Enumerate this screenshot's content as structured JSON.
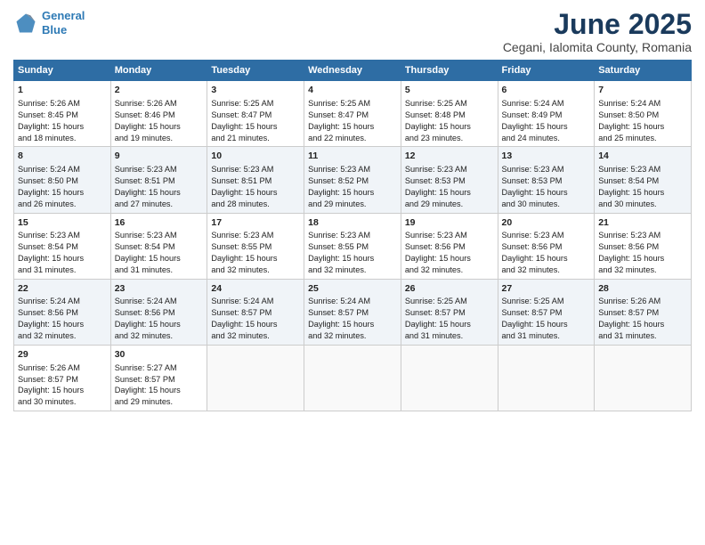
{
  "logo": {
    "line1": "General",
    "line2": "Blue"
  },
  "title": "June 2025",
  "subtitle": "Cegani, Ialomita County, Romania",
  "header": {
    "accent_color": "#2e6da4",
    "days": [
      "Sunday",
      "Monday",
      "Tuesday",
      "Wednesday",
      "Thursday",
      "Friday",
      "Saturday"
    ]
  },
  "weeks": [
    {
      "cells": [
        {
          "day": "1",
          "content": "Sunrise: 5:26 AM\nSunset: 8:45 PM\nDaylight: 15 hours\nand 18 minutes."
        },
        {
          "day": "2",
          "content": "Sunrise: 5:26 AM\nSunset: 8:46 PM\nDaylight: 15 hours\nand 19 minutes."
        },
        {
          "day": "3",
          "content": "Sunrise: 5:25 AM\nSunset: 8:47 PM\nDaylight: 15 hours\nand 21 minutes."
        },
        {
          "day": "4",
          "content": "Sunrise: 5:25 AM\nSunset: 8:47 PM\nDaylight: 15 hours\nand 22 minutes."
        },
        {
          "day": "5",
          "content": "Sunrise: 5:25 AM\nSunset: 8:48 PM\nDaylight: 15 hours\nand 23 minutes."
        },
        {
          "day": "6",
          "content": "Sunrise: 5:24 AM\nSunset: 8:49 PM\nDaylight: 15 hours\nand 24 minutes."
        },
        {
          "day": "7",
          "content": "Sunrise: 5:24 AM\nSunset: 8:50 PM\nDaylight: 15 hours\nand 25 minutes."
        }
      ]
    },
    {
      "cells": [
        {
          "day": "8",
          "content": "Sunrise: 5:24 AM\nSunset: 8:50 PM\nDaylight: 15 hours\nand 26 minutes."
        },
        {
          "day": "9",
          "content": "Sunrise: 5:23 AM\nSunset: 8:51 PM\nDaylight: 15 hours\nand 27 minutes."
        },
        {
          "day": "10",
          "content": "Sunrise: 5:23 AM\nSunset: 8:51 PM\nDaylight: 15 hours\nand 28 minutes."
        },
        {
          "day": "11",
          "content": "Sunrise: 5:23 AM\nSunset: 8:52 PM\nDaylight: 15 hours\nand 29 minutes."
        },
        {
          "day": "12",
          "content": "Sunrise: 5:23 AM\nSunset: 8:53 PM\nDaylight: 15 hours\nand 29 minutes."
        },
        {
          "day": "13",
          "content": "Sunrise: 5:23 AM\nSunset: 8:53 PM\nDaylight: 15 hours\nand 30 minutes."
        },
        {
          "day": "14",
          "content": "Sunrise: 5:23 AM\nSunset: 8:54 PM\nDaylight: 15 hours\nand 30 minutes."
        }
      ]
    },
    {
      "cells": [
        {
          "day": "15",
          "content": "Sunrise: 5:23 AM\nSunset: 8:54 PM\nDaylight: 15 hours\nand 31 minutes."
        },
        {
          "day": "16",
          "content": "Sunrise: 5:23 AM\nSunset: 8:54 PM\nDaylight: 15 hours\nand 31 minutes."
        },
        {
          "day": "17",
          "content": "Sunrise: 5:23 AM\nSunset: 8:55 PM\nDaylight: 15 hours\nand 32 minutes."
        },
        {
          "day": "18",
          "content": "Sunrise: 5:23 AM\nSunset: 8:55 PM\nDaylight: 15 hours\nand 32 minutes."
        },
        {
          "day": "19",
          "content": "Sunrise: 5:23 AM\nSunset: 8:56 PM\nDaylight: 15 hours\nand 32 minutes."
        },
        {
          "day": "20",
          "content": "Sunrise: 5:23 AM\nSunset: 8:56 PM\nDaylight: 15 hours\nand 32 minutes."
        },
        {
          "day": "21",
          "content": "Sunrise: 5:23 AM\nSunset: 8:56 PM\nDaylight: 15 hours\nand 32 minutes."
        }
      ]
    },
    {
      "cells": [
        {
          "day": "22",
          "content": "Sunrise: 5:24 AM\nSunset: 8:56 PM\nDaylight: 15 hours\nand 32 minutes."
        },
        {
          "day": "23",
          "content": "Sunrise: 5:24 AM\nSunset: 8:56 PM\nDaylight: 15 hours\nand 32 minutes."
        },
        {
          "day": "24",
          "content": "Sunrise: 5:24 AM\nSunset: 8:57 PM\nDaylight: 15 hours\nand 32 minutes."
        },
        {
          "day": "25",
          "content": "Sunrise: 5:24 AM\nSunset: 8:57 PM\nDaylight: 15 hours\nand 32 minutes."
        },
        {
          "day": "26",
          "content": "Sunrise: 5:25 AM\nSunset: 8:57 PM\nDaylight: 15 hours\nand 31 minutes."
        },
        {
          "day": "27",
          "content": "Sunrise: 5:25 AM\nSunset: 8:57 PM\nDaylight: 15 hours\nand 31 minutes."
        },
        {
          "day": "28",
          "content": "Sunrise: 5:26 AM\nSunset: 8:57 PM\nDaylight: 15 hours\nand 31 minutes."
        }
      ]
    },
    {
      "cells": [
        {
          "day": "29",
          "content": "Sunrise: 5:26 AM\nSunset: 8:57 PM\nDaylight: 15 hours\nand 30 minutes."
        },
        {
          "day": "30",
          "content": "Sunrise: 5:27 AM\nSunset: 8:57 PM\nDaylight: 15 hours\nand 29 minutes."
        },
        {
          "day": "",
          "content": ""
        },
        {
          "day": "",
          "content": ""
        },
        {
          "day": "",
          "content": ""
        },
        {
          "day": "",
          "content": ""
        },
        {
          "day": "",
          "content": ""
        }
      ]
    }
  ]
}
